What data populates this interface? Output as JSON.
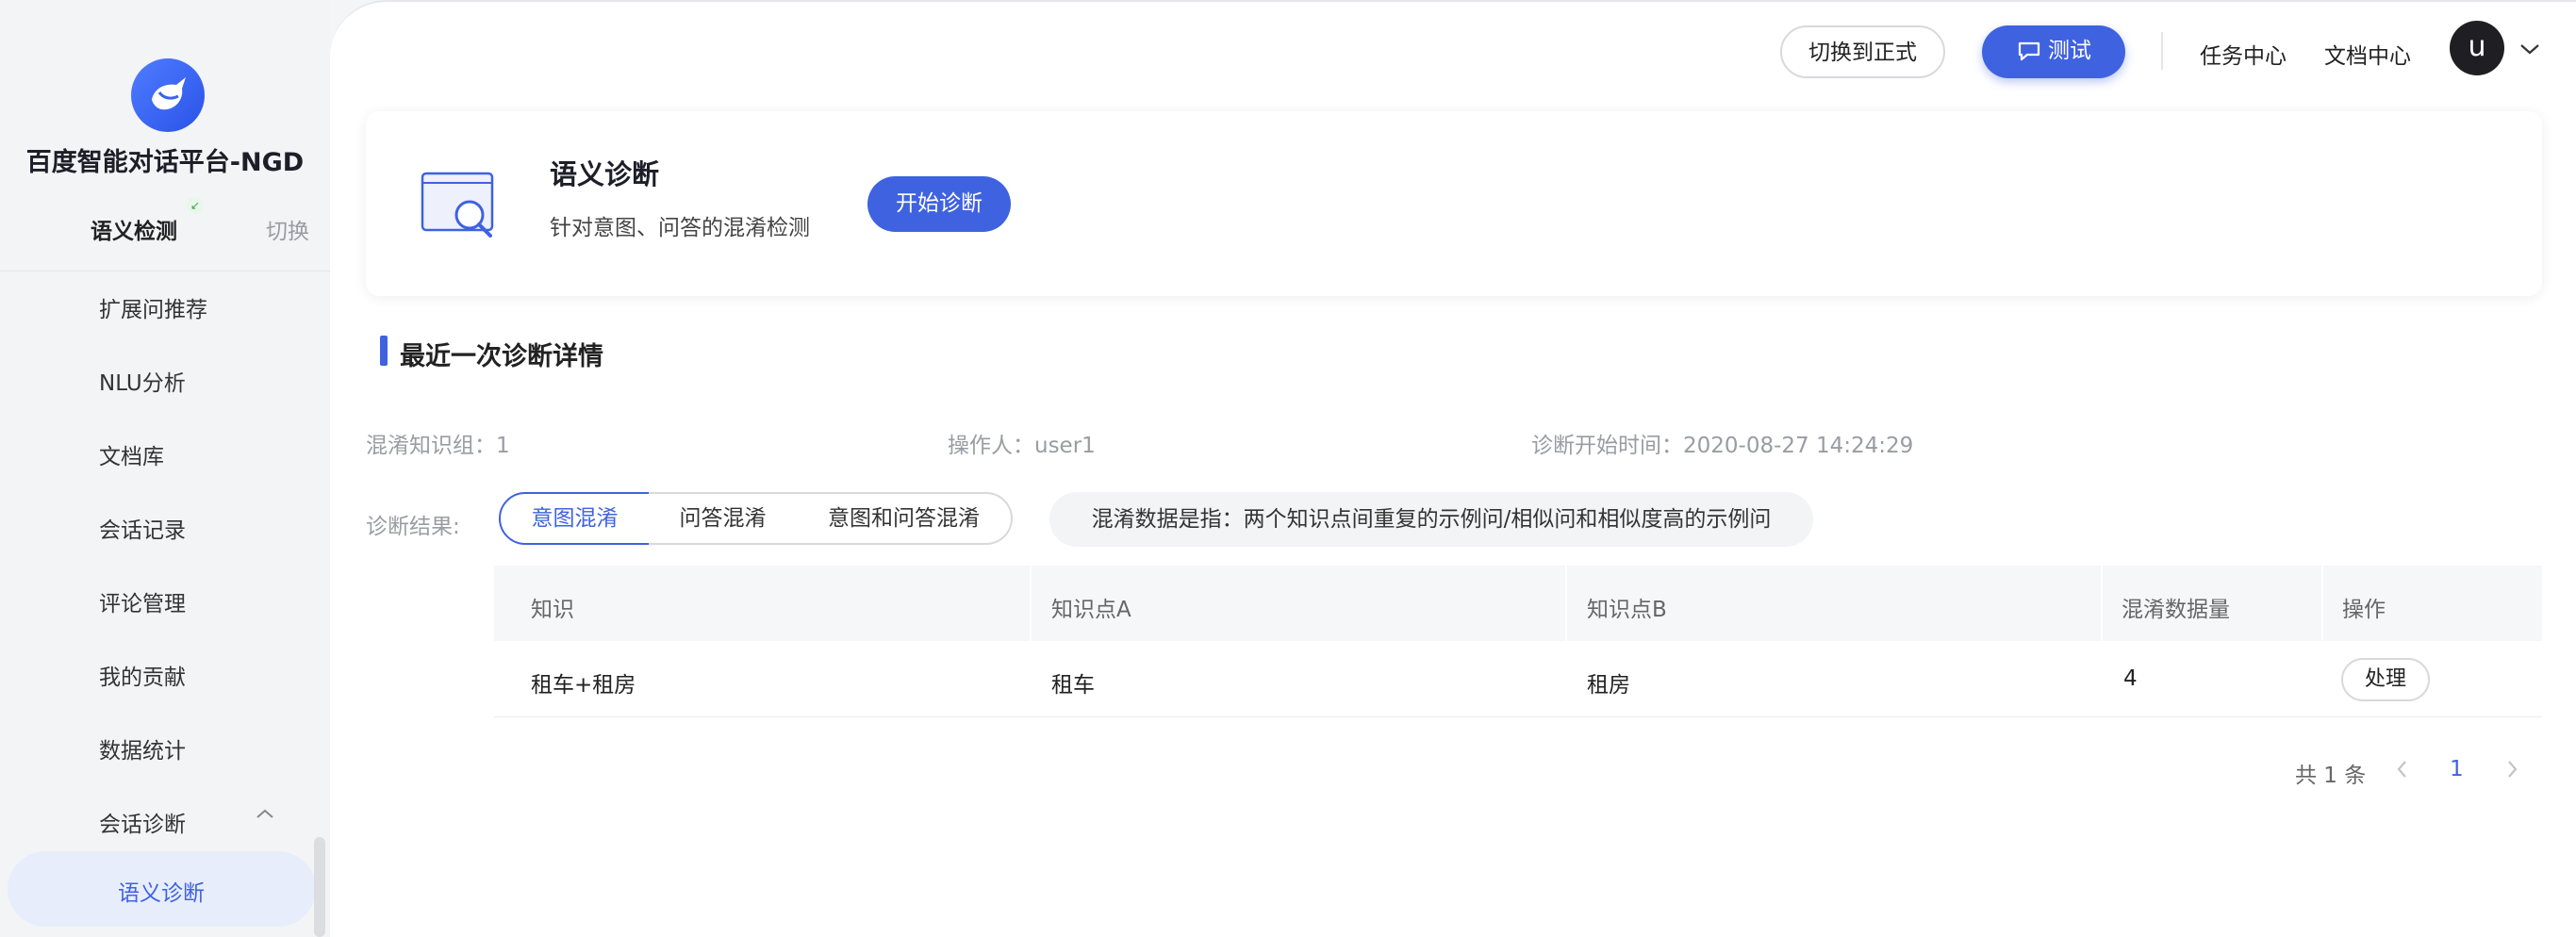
{
  "sidebar": {
    "brand": "百度智能对话平台-NGD",
    "mode_label": "语义检测",
    "switch_label": "切换",
    "items": [
      {
        "label": "扩展问推荐"
      },
      {
        "label": "NLU分析"
      },
      {
        "label": "文档库"
      },
      {
        "label": "会话记录"
      },
      {
        "label": "评论管理"
      },
      {
        "label": "我的贡献"
      },
      {
        "label": "数据统计"
      },
      {
        "label": "会话诊断"
      }
    ],
    "active_item": "语义诊断"
  },
  "header": {
    "switch_formal": "切换到正式",
    "test": "测试",
    "task_center": "任务中心",
    "doc_center": "文档中心",
    "avatar_letter": "u"
  },
  "card": {
    "title": "语义诊断",
    "desc": "针对意图、问答的混淆检测",
    "start_button": "开始诊断"
  },
  "section": {
    "title": "最近一次诊断详情"
  },
  "meta": {
    "group": "混淆知识组：1",
    "operator": "操作人：user1",
    "start_time": "诊断开始时间：2020-08-27 14:24:29"
  },
  "filter": {
    "label": "诊断结果:",
    "options": [
      "意图混淆",
      "问答混淆",
      "意图和问答混淆"
    ],
    "selected": "意图混淆",
    "note": "混淆数据是指：两个知识点间重复的示例问/相似问和相似度高的示例问"
  },
  "table": {
    "headers": [
      "知识",
      "知识点A",
      "知识点B",
      "混淆数据量",
      "操作"
    ],
    "rows": [
      {
        "knowledge": "租车+租房",
        "a": "租车",
        "b": "租房",
        "count": "4",
        "action": "处理"
      }
    ]
  },
  "pagination": {
    "total": "共 1 条",
    "current": "1"
  },
  "colors": {
    "accent": "#3f62e0",
    "sidebar_bg": "#f3f4f6",
    "active_bg": "#e8edfc"
  }
}
